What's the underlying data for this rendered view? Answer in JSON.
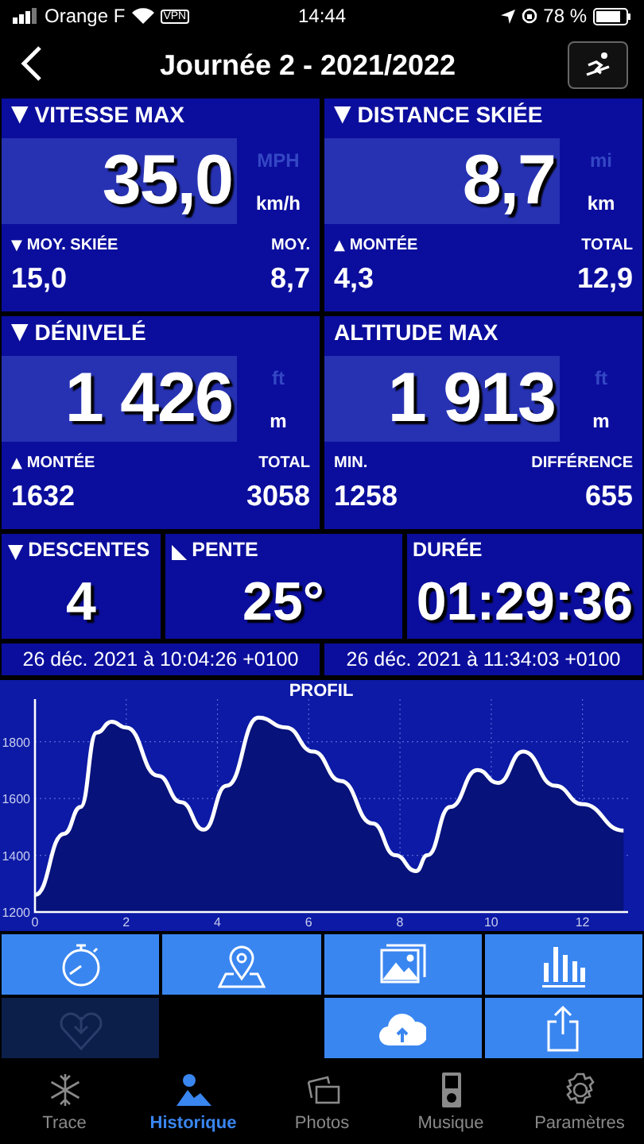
{
  "status_bar": {
    "carrier": "Orange F",
    "vpn": "VPN",
    "time": "14:44",
    "battery": "78 %"
  },
  "nav": {
    "title": "Journée 2 - 2021/2022"
  },
  "stats": [
    {
      "title": "VITESSE MAX",
      "marker": "▼",
      "value": "35,0",
      "units": [
        {
          "label": "MPH",
          "selected": false
        },
        {
          "label": "km/h",
          "selected": true
        }
      ],
      "sub": {
        "left_label": "MOY. SKIÉE",
        "left_marker": "▼",
        "left_value": "15,0",
        "right_label": "MOY.",
        "right_value": "8,7"
      }
    },
    {
      "title": "DISTANCE SKIÉE",
      "marker": "▼",
      "value": "8,7",
      "units": [
        {
          "label": "mi",
          "selected": false
        },
        {
          "label": "km",
          "selected": true
        }
      ],
      "sub": {
        "left_label": "MONTÉE",
        "left_marker": "▲",
        "left_value": "4,3",
        "right_label": "TOTAL",
        "right_value": "12,9"
      }
    },
    {
      "title": "DÉNIVELÉ",
      "marker": "▼",
      "value": "1 426",
      "units": [
        {
          "label": "ft",
          "selected": false
        },
        {
          "label": "m",
          "selected": true
        }
      ],
      "sub": {
        "left_label": "MONTÉE",
        "left_marker": "▲",
        "left_value": "1632",
        "right_label": "TOTAL",
        "right_value": "3058"
      }
    },
    {
      "title": "ALTITUDE MAX",
      "value": "1 913",
      "units": [
        {
          "label": "ft",
          "selected": false
        },
        {
          "label": "m",
          "selected": true
        }
      ],
      "sub": {
        "left_label": "MIN.",
        "left_value": "1258",
        "right_label": "DIFFÉRENCE",
        "right_value": "655"
      }
    }
  ],
  "small_stats": [
    {
      "title": "DESCENTES",
      "marker": "▼",
      "value": "4"
    },
    {
      "title": "PENTE",
      "marker": "◣",
      "value": "25°"
    },
    {
      "title": "DURÉE",
      "value": "01:29:36"
    }
  ],
  "dates": [
    "26 déc. 2021 à 10:04:26 +0100",
    "26 déc. 2021 à 11:34:03 +0100"
  ],
  "profile": {
    "chart_data": {
      "type": "area",
      "title": "PROFIL",
      "x": [
        0,
        0.64,
        1.0,
        1.35,
        1.68,
        2.0,
        2.7,
        3.2,
        3.7,
        4.2,
        4.9,
        5.5,
        6.1,
        6.7,
        7.4,
        7.9,
        8.35,
        8.6,
        9.1,
        9.7,
        10.15,
        10.7,
        11.4,
        12.0,
        12.9
      ],
      "grid": true,
      "series": [
        {
          "color": "#ffffff",
          "values": [
            1260,
            1476,
            1570,
            1832,
            1870,
            1850,
            1680,
            1587,
            1490,
            1645,
            1885,
            1850,
            1765,
            1662,
            1512,
            1400,
            1344,
            1400,
            1570,
            1700,
            1655,
            1765,
            1645,
            1580,
            1487
          ]
        }
      ],
      "xlim": [
        0,
        13
      ],
      "ylim": [
        1200,
        1950
      ],
      "xticks": [
        0,
        2,
        4,
        6,
        8,
        10,
        12
      ],
      "yticks": [
        1200,
        1400,
        1600,
        1800
      ]
    }
  },
  "actions": [
    {
      "kind": "stopwatch",
      "disabled": false
    },
    {
      "kind": "map-pin",
      "disabled": false
    },
    {
      "kind": "photos",
      "disabled": false
    },
    {
      "kind": "bars",
      "disabled": false
    },
    {
      "kind": "heart",
      "disabled": true
    },
    {
      "kind": "cloud-upload",
      "disabled": false
    },
    {
      "kind": "share",
      "disabled": false
    }
  ],
  "tabs": [
    {
      "label": "Trace",
      "kind": "snowflake",
      "selected": false
    },
    {
      "label": "Historique",
      "kind": "mountain",
      "selected": true
    },
    {
      "label": "Photos",
      "kind": "photos",
      "selected": false
    },
    {
      "label": "Musique",
      "kind": "player",
      "selected": false
    },
    {
      "label": "Paramètres",
      "kind": "gear",
      "selected": false
    }
  ]
}
